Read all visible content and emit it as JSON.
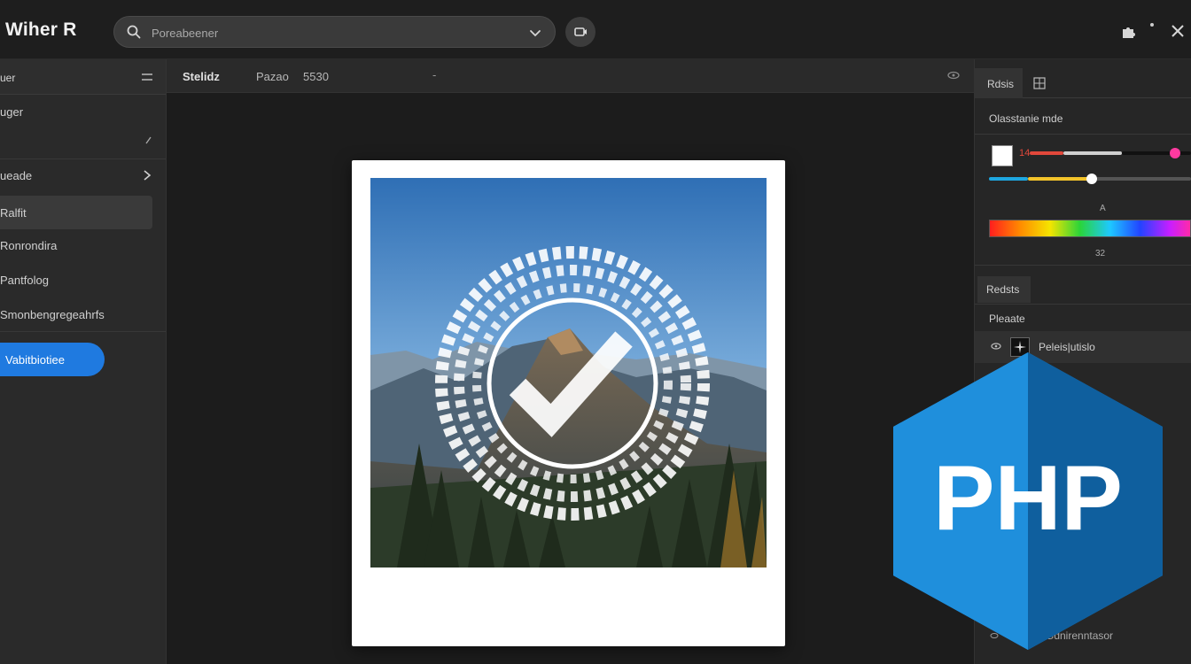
{
  "app": {
    "title": "Wiher R"
  },
  "search": {
    "placeholder": "Poreabeener"
  },
  "sidebar": {
    "header": "uer",
    "items": [
      {
        "label": "uger"
      },
      {
        "label": ""
      },
      {
        "label": "ueade"
      },
      {
        "label": "Ralfit"
      },
      {
        "label": "Ronrondira"
      },
      {
        "label": "Pantfolog"
      },
      {
        "label": "Smonbengregeahrfs"
      }
    ],
    "button": "Vabitbiotiee"
  },
  "main": {
    "header": {
      "title": "Stelidz",
      "field1": "Pazao",
      "field2": "5530",
      "field3": "-"
    }
  },
  "right_panel": {
    "tabs": [
      "Rdsis"
    ],
    "color_section_title": "Olasstanie mde",
    "hex_value": "14",
    "label_a": "A",
    "label_b": "32",
    "layers_tab": "Redsts",
    "layers_title": "Pleaate",
    "layer_name": "Peleis|utislo",
    "bottom_layer_name": "Gdnirenntasor"
  },
  "badge": {
    "text": "PHP"
  },
  "colors": {
    "accent": "#1f7ae0",
    "badge_blue": "#1b82cf",
    "badge_dark": "#0f5f9e",
    "hex_text": "#e2483b"
  }
}
